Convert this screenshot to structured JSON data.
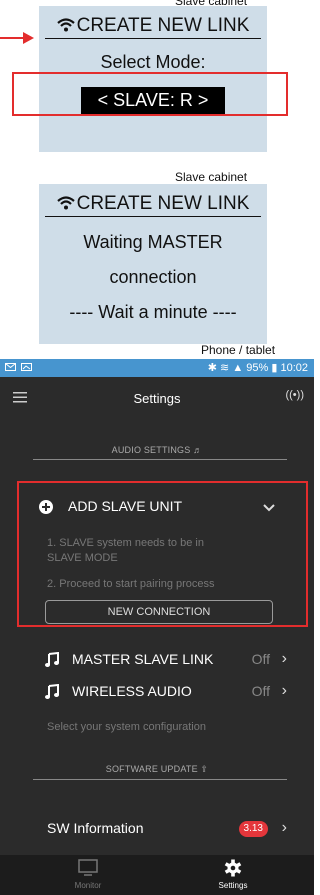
{
  "captions": {
    "top": "Slave cabinet",
    "middle": "Slave cabinet",
    "phone": "Phone / tablet"
  },
  "lcd1": {
    "title": "CREATE NEW LINK",
    "line1": "Select Mode:",
    "mode": "< SLAVE: R >"
  },
  "lcd2": {
    "title": "CREATE NEW LINK",
    "line1": "Waiting MASTER",
    "line2": "connection",
    "line3": "---- Wait a minute ----"
  },
  "phone": {
    "status": {
      "right": "95% ▮ 10:02"
    },
    "title": "Settings",
    "cast_icon": "((•))",
    "audio_section": "AUDIO SETTINGS ♬",
    "add_slave": {
      "label": "ADD SLAVE UNIT",
      "step1_line1": "1. SLAVE system needs to be in",
      "step1_line2": "SLAVE MODE",
      "step2": "2. Proceed to start pairing process",
      "button": "NEW CONNECTION"
    },
    "master_slave": {
      "label": "MASTER SLAVE LINK",
      "value": "Off"
    },
    "wireless": {
      "label": "WIRELESS AUDIO",
      "value": "Off"
    },
    "config_hint": "Select your system configuration",
    "software_section": "SOFTWARE UPDATE ⇪",
    "sw": {
      "label": "SW Information",
      "badge": "3.13"
    },
    "tabs": [
      {
        "label": "Monitor",
        "icon": "monitor-icon"
      },
      {
        "label": "Settings",
        "icon": "gear-icon"
      }
    ]
  },
  "colors": {
    "lcd_bg": "#cfdde8",
    "highlight": "#e32d2d",
    "statusbar": "#4795cf",
    "app_bg": "#2b2b2b",
    "badge": "#e4363b"
  }
}
